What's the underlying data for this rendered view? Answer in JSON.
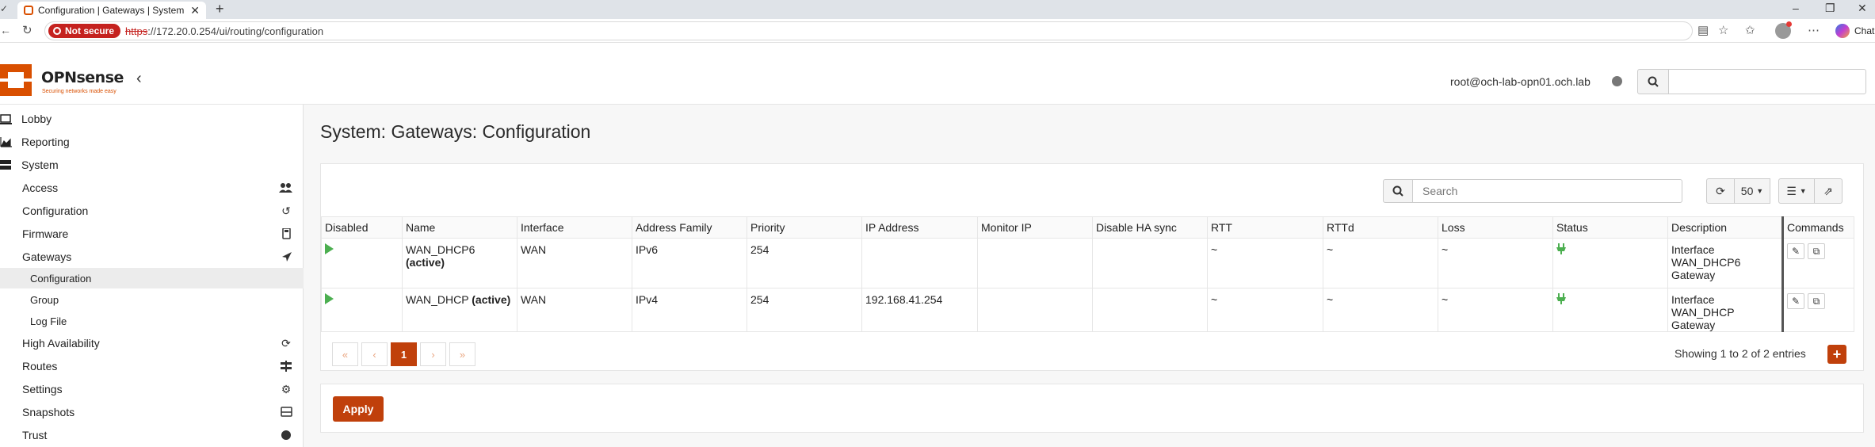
{
  "browser": {
    "tab_title": "Configuration | Gateways | System",
    "url_scheme": "https",
    "url_rest": "://172.20.0.254/ui/routing/configuration",
    "security_label": "Not secure",
    "copilot_label": "Chat"
  },
  "header": {
    "brand": "OPNsense",
    "brand_tagline": "Securing networks made easy",
    "user": "root@och-lab-opn01.och.lab"
  },
  "sidebar": {
    "items": [
      {
        "label": "Lobby",
        "icon": "laptop-icon"
      },
      {
        "label": "Reporting",
        "icon": "area-chart-icon"
      },
      {
        "label": "System",
        "icon": "server-icon"
      },
      {
        "label": "Access",
        "icon": "users-icon"
      },
      {
        "label": "Configuration",
        "icon": "history-icon"
      },
      {
        "label": "Firmware",
        "icon": "calculator-icon"
      },
      {
        "label": "Gateways",
        "icon": "location-arrow-icon"
      },
      {
        "label": "Configuration"
      },
      {
        "label": "Group"
      },
      {
        "label": "Log File"
      },
      {
        "label": "High Availability",
        "icon": "refresh-icon"
      },
      {
        "label": "Routes",
        "icon": "signpost-icon"
      },
      {
        "label": "Settings",
        "icon": "cogs-icon"
      },
      {
        "label": "Snapshots",
        "icon": "hdd-icon"
      },
      {
        "label": "Trust",
        "icon": "certificate-icon"
      }
    ]
  },
  "main": {
    "title": "System: Gateways: Configuration",
    "search_placeholder": "Search",
    "page_size": "50",
    "columns": [
      "Disabled",
      "Name",
      "Interface",
      "Address Family",
      "Priority",
      "IP Address",
      "Monitor IP",
      "Disable HA sync",
      "RTT",
      "RTTd",
      "Loss",
      "Status",
      "Description",
      "Commands"
    ],
    "rows": [
      {
        "name": "WAN_DHCP6",
        "active": "(active)",
        "interface": "WAN",
        "family": "IPv6",
        "priority": "254",
        "ip": "",
        "monitor": "",
        "ha": "",
        "rtt": "~",
        "rttd": "~",
        "loss": "~",
        "description": "Interface WAN_DHCP6 Gateway"
      },
      {
        "name": "WAN_DHCP",
        "active": "(active)",
        "interface": "WAN",
        "family": "IPv4",
        "priority": "254",
        "ip": "192.168.41.254",
        "monitor": "",
        "ha": "",
        "rtt": "~",
        "rttd": "~",
        "loss": "~",
        "description": "Interface WAN_DHCP Gateway"
      }
    ],
    "pager": {
      "first": "«",
      "prev": "‹",
      "current": "1",
      "next": "›",
      "last": "»"
    },
    "showing": "Showing 1 to 2 of 2 entries",
    "add_label": "+",
    "apply_label": "Apply"
  },
  "colors": {
    "brand": "#d94f00",
    "button": "#c0400b",
    "status_ok": "#4caf50"
  }
}
